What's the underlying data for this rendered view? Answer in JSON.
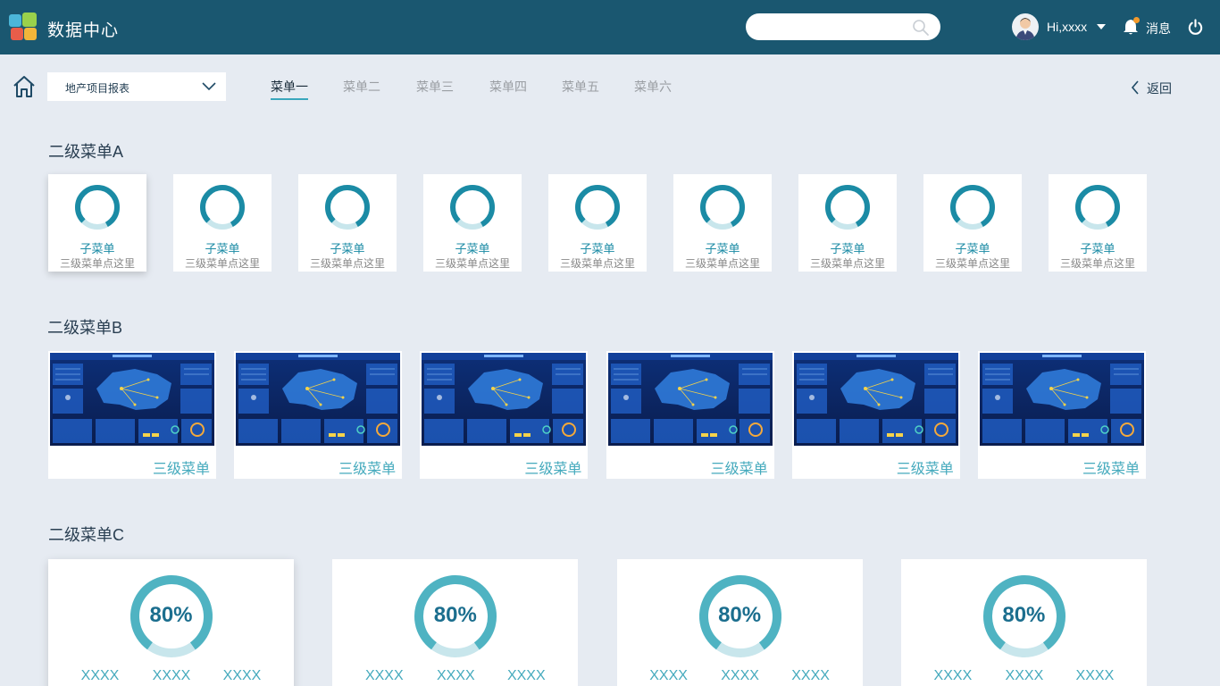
{
  "header": {
    "app_title": "数据中心",
    "search_placeholder": "",
    "user_greeting": "Hi,xxxx",
    "messages_label": "消息",
    "icons": [
      "logo-icon",
      "search-icon",
      "avatar",
      "chevron-down-icon",
      "bell-icon",
      "power-icon"
    ],
    "notification_dot_color": "#f39a2b"
  },
  "nav": {
    "project_select": "地产项目报表",
    "tabs": [
      {
        "label": "菜单一",
        "active": true
      },
      {
        "label": "菜单二"
      },
      {
        "label": "菜单三"
      },
      {
        "label": "菜单四"
      },
      {
        "label": "菜单五"
      },
      {
        "label": "菜单六"
      }
    ],
    "back_label": "返回"
  },
  "section_a": {
    "title": "二级菜单A",
    "items": [
      {
        "title": "子菜单",
        "subtitle": "三级菜单点这里"
      },
      {
        "title": "子菜单",
        "subtitle": "三级菜单点这里"
      },
      {
        "title": "子菜单",
        "subtitle": "三级菜单点这里"
      },
      {
        "title": "子菜单",
        "subtitle": "三级菜单点这里"
      },
      {
        "title": "子菜单",
        "subtitle": "三级菜单点这里"
      },
      {
        "title": "子菜单",
        "subtitle": "三级菜单点这里"
      },
      {
        "title": "子菜单",
        "subtitle": "三级菜单点这里"
      },
      {
        "title": "子菜单",
        "subtitle": "三级菜单点这里"
      },
      {
        "title": "子菜单",
        "subtitle": "三级菜单点这里"
      }
    ]
  },
  "section_b": {
    "title": "二级菜单B",
    "items": [
      {
        "label": "三级菜单"
      },
      {
        "label": "三级菜单"
      },
      {
        "label": "三级菜单"
      },
      {
        "label": "三级菜单"
      },
      {
        "label": "三级菜单"
      },
      {
        "label": "三级菜单"
      }
    ]
  },
  "section_c": {
    "title": "二级菜单C",
    "items": [
      {
        "percent": "80%",
        "progress": 0.8,
        "labels": [
          "XXXX",
          "XXXX",
          "XXXX"
        ]
      },
      {
        "percent": "80%",
        "progress": 0.8,
        "labels": [
          "XXXX",
          "XXXX",
          "XXXX"
        ]
      },
      {
        "percent": "80%",
        "progress": 0.8,
        "labels": [
          "XXXX",
          "XXXX",
          "XXXX"
        ]
      },
      {
        "percent": "80%",
        "progress": 0.8,
        "labels": [
          "XXXX",
          "XXXX",
          "XXXX"
        ]
      }
    ]
  },
  "colors": {
    "header_bg": "#1a5770",
    "page_bg": "#e6ebf2",
    "accent": "#1b8ba5",
    "ring_track": "#c8e6ec",
    "ring_fill_c": "#4fb3c2"
  }
}
